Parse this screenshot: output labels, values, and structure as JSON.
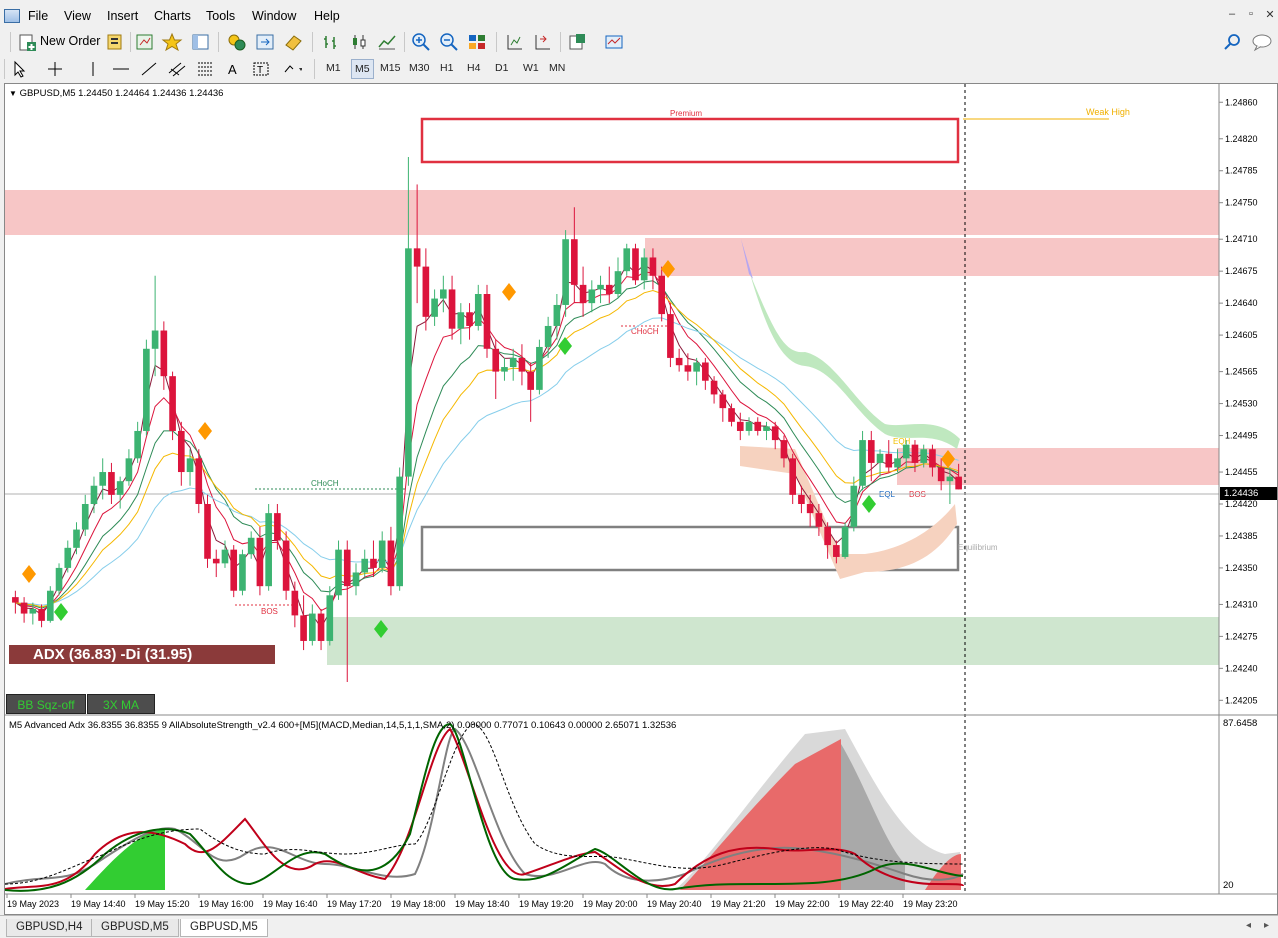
{
  "menu": {
    "items": [
      "File",
      "View",
      "Insert",
      "Charts",
      "Tools",
      "Window",
      "Help"
    ],
    "window_controls": [
      "–",
      "▫",
      "✕"
    ]
  },
  "toolbar": {
    "new_order_label": "New Order",
    "timeframes": [
      "M1",
      "M5",
      "M15",
      "M30",
      "H1",
      "H4",
      "D1",
      "W1",
      "MN"
    ],
    "active_timeframe": "M5"
  },
  "chart": {
    "header": "GBPUSD,M5  1.24450 1.24464 1.24436 1.24436",
    "current_price": "1.24436",
    "price_labels": [
      "1.24860",
      "1.24820",
      "1.24785",
      "1.24750",
      "1.24710",
      "1.24675",
      "1.24640",
      "1.24605",
      "1.24565",
      "1.24530",
      "1.24495",
      "1.24455",
      "1.24420",
      "1.24385",
      "1.24350",
      "1.24310",
      "1.24275",
      "1.24240",
      "1.24205"
    ],
    "time_labels": [
      "19 May 2023",
      "19 May 14:40",
      "19 May 15:20",
      "19 May 16:00",
      "19 May 16:40",
      "19 May 17:20",
      "19 May 18:00",
      "19 May 18:40",
      "19 May 19:20",
      "19 May 20:00",
      "19 May 20:40",
      "19 May 21:20",
      "19 May 22:00",
      "19 May 22:40",
      "19 May 23:20"
    ],
    "annotations": {
      "premium": "Premium",
      "weak_high": "Weak High",
      "equilibrium": "Equilibrium",
      "choch": "CHoCH",
      "bos": "BOS",
      "eqh": "EQH",
      "eql": "EQL"
    },
    "adx_label": "ADX (36.83)  -Di (31.95)",
    "bb_button": "BB Sqz-off",
    "ma_button": "3X MA",
    "subwindow_header": "M5 Advanced Adx 36.8355 36.8355      9 AllAbsoluteStrength_v2.4 600+[M5](MACD,Median,14,5,1,1,SMA,2) 0.00000 0.77071 0.10643 0.00000 2.65071 1.32536",
    "subwindow_top_value": "87.6458",
    "subwindow_bottom_value": "20",
    "colors": {
      "bull": "#3cb371",
      "bear": "#dc143c",
      "neutral": "#778899",
      "premium_zone": "#f7c6c6",
      "discount_zone": "#cfe6cf"
    }
  },
  "chart_data": {
    "type": "candlestick",
    "symbol": "GBPUSD",
    "timeframe": "M5",
    "ylim": [
      1.2419,
      1.2488
    ],
    "y_ticks": [
      1.2486,
      1.2482,
      1.24785,
      1.2475,
      1.2471,
      1.24675,
      1.2464,
      1.24605,
      1.24565,
      1.2453,
      1.24495,
      1.24455,
      1.2442,
      1.24385,
      1.2435,
      1.2431,
      1.24275,
      1.2424,
      1.24205
    ],
    "current_price": 1.24436,
    "candles": [
      [
        1.24318,
        1.24325,
        1.243,
        1.24312
      ],
      [
        1.24312,
        1.24318,
        1.2429,
        1.243
      ],
      [
        1.243,
        1.24312,
        1.24288,
        1.24305
      ],
      [
        1.24305,
        1.2431,
        1.24285,
        1.24292
      ],
      [
        1.24292,
        1.2433,
        1.2429,
        1.24325
      ],
      [
        1.24325,
        1.24355,
        1.2432,
        1.2435
      ],
      [
        1.2435,
        1.2438,
        1.24345,
        1.24372
      ],
      [
        1.24372,
        1.244,
        1.24365,
        1.24392
      ],
      [
        1.24392,
        1.2443,
        1.24385,
        1.2442
      ],
      [
        1.2442,
        1.2445,
        1.2441,
        1.2444
      ],
      [
        1.2444,
        1.2447,
        1.24425,
        1.24455
      ],
      [
        1.24455,
        1.24465,
        1.2442,
        1.2443
      ],
      [
        1.2443,
        1.2445,
        1.24415,
        1.24445
      ],
      [
        1.24445,
        1.2448,
        1.2444,
        1.2447
      ],
      [
        1.2447,
        1.2451,
        1.24465,
        1.245
      ],
      [
        1.245,
        1.246,
        1.24495,
        1.2459
      ],
      [
        1.2459,
        1.2467,
        1.2456,
        1.2461
      ],
      [
        1.2461,
        1.2462,
        1.24545,
        1.2456
      ],
      [
        1.2456,
        1.24565,
        1.2449,
        1.245
      ],
      [
        1.245,
        1.2451,
        1.2444,
        1.24455
      ],
      [
        1.24455,
        1.2448,
        1.2444,
        1.2447
      ],
      [
        1.2447,
        1.2448,
        1.2441,
        1.2442
      ],
      [
        1.2442,
        1.2443,
        1.2435,
        1.2436
      ],
      [
        1.2436,
        1.2437,
        1.2434,
        1.24355
      ],
      [
        1.24355,
        1.2438,
        1.2435,
        1.2437
      ],
      [
        1.2437,
        1.24375,
        1.24318,
        1.24325
      ],
      [
        1.24325,
        1.2437,
        1.2432,
        1.24365
      ],
      [
        1.24365,
        1.2439,
        1.2436,
        1.24383
      ],
      [
        1.24383,
        1.24395,
        1.2432,
        1.2433
      ],
      [
        1.2433,
        1.2442,
        1.24325,
        1.2441
      ],
      [
        1.2441,
        1.2442,
        1.2437,
        1.2438
      ],
      [
        1.2438,
        1.2439,
        1.24315,
        1.24325
      ],
      [
        1.24325,
        1.24335,
        1.24285,
        1.24298
      ],
      [
        1.24298,
        1.2432,
        1.2426,
        1.2427
      ],
      [
        1.2427,
        1.2431,
        1.24265,
        1.243
      ],
      [
        1.243,
        1.24305,
        1.2426,
        1.2427
      ],
      [
        1.2427,
        1.2433,
        1.24265,
        1.2432
      ],
      [
        1.2432,
        1.2438,
        1.24315,
        1.2437
      ],
      [
        1.2437,
        1.2438,
        1.24225,
        1.2433
      ],
      [
        1.2433,
        1.24355,
        1.2432,
        1.24345
      ],
      [
        1.24345,
        1.2437,
        1.2434,
        1.2436
      ],
      [
        1.2436,
        1.2438,
        1.2434,
        1.2435
      ],
      [
        1.2435,
        1.2439,
        1.24345,
        1.2438
      ],
      [
        1.2438,
        1.24395,
        1.2432,
        1.2433
      ],
      [
        1.2433,
        1.2446,
        1.24325,
        1.2445
      ],
      [
        1.2445,
        1.248,
        1.2444,
        1.247
      ],
      [
        1.247,
        1.2477,
        1.2464,
        1.2468
      ],
      [
        1.2468,
        1.247,
        1.2461,
        1.24625
      ],
      [
        1.24625,
        1.24655,
        1.24615,
        1.24645
      ],
      [
        1.24645,
        1.2467,
        1.2463,
        1.24655
      ],
      [
        1.24655,
        1.2467,
        1.246,
        1.24612
      ],
      [
        1.24612,
        1.2464,
        1.24595,
        1.2463
      ],
      [
        1.2463,
        1.2464,
        1.246,
        1.24615
      ],
      [
        1.24615,
        1.2466,
        1.2461,
        1.2465
      ],
      [
        1.2465,
        1.2466,
        1.2458,
        1.2459
      ],
      [
        1.2459,
        1.246,
        1.24535,
        1.24565
      ],
      [
        1.24565,
        1.2458,
        1.24555,
        1.2457
      ],
      [
        1.2457,
        1.2459,
        1.24555,
        1.2458
      ],
      [
        1.2458,
        1.24595,
        1.2455,
        1.24565
      ],
      [
        1.24565,
        1.24575,
        1.2451,
        1.24545
      ],
      [
        1.24545,
        1.246,
        1.2454,
        1.24592
      ],
      [
        1.24592,
        1.24625,
        1.2458,
        1.24615
      ],
      [
        1.24615,
        1.2465,
        1.246,
        1.24638
      ],
      [
        1.24638,
        1.2472,
        1.24625,
        1.2471
      ],
      [
        1.2471,
        1.24745,
        1.2464,
        1.2466
      ],
      [
        1.2466,
        1.2468,
        1.24625,
        1.2464
      ],
      [
        1.2464,
        1.24665,
        1.2463,
        1.24655
      ],
      [
        1.24655,
        1.2467,
        1.2464,
        1.2466
      ],
      [
        1.2466,
        1.2468,
        1.2464,
        1.2465
      ],
      [
        1.2465,
        1.2469,
        1.24645,
        1.24675
      ],
      [
        1.24675,
        1.24705,
        1.2467,
        1.247
      ],
      [
        1.247,
        1.24705,
        1.2466,
        1.24665
      ],
      [
        1.24665,
        1.247,
        1.24655,
        1.2469
      ],
      [
        1.2469,
        1.247,
        1.24655,
        1.2467
      ],
      [
        1.2467,
        1.2468,
        1.2462,
        1.24628
      ],
      [
        1.24628,
        1.2464,
        1.2457,
        1.2458
      ],
      [
        1.2458,
        1.2459,
        1.24565,
        1.24572
      ],
      [
        1.24572,
        1.24585,
        1.24555,
        1.24565
      ],
      [
        1.24565,
        1.2458,
        1.2455,
        1.24575
      ],
      [
        1.24575,
        1.2458,
        1.24545,
        1.24555
      ],
      [
        1.24555,
        1.2456,
        1.2453,
        1.2454
      ],
      [
        1.2454,
        1.24545,
        1.2451,
        1.24525
      ],
      [
        1.24525,
        1.2453,
        1.24505,
        1.2451
      ],
      [
        1.2451,
        1.2452,
        1.2449,
        1.245
      ],
      [
        1.245,
        1.24515,
        1.24495,
        1.2451
      ],
      [
        1.2451,
        1.24515,
        1.24495,
        1.245
      ],
      [
        1.245,
        1.2451,
        1.2449,
        1.24505
      ],
      [
        1.24505,
        1.2451,
        1.2448,
        1.2449
      ],
      [
        1.2449,
        1.24495,
        1.2446,
        1.2447
      ],
      [
        1.2447,
        1.24475,
        1.2442,
        1.2443
      ],
      [
        1.2443,
        1.2444,
        1.2441,
        1.2442
      ],
      [
        1.2442,
        1.2443,
        1.24395,
        1.2441
      ],
      [
        1.2441,
        1.2442,
        1.24385,
        1.24395
      ],
      [
        1.24395,
        1.244,
        1.2436,
        1.24375
      ],
      [
        1.24375,
        1.2438,
        1.24355,
        1.24362
      ],
      [
        1.24362,
        1.244,
        1.2436,
        1.24395
      ],
      [
        1.24395,
        1.2445,
        1.2439,
        1.2444
      ],
      [
        1.2444,
        1.245,
        1.24435,
        1.2449
      ],
      [
        1.2449,
        1.245,
        1.24445,
        1.24465
      ],
      [
        1.24465,
        1.2448,
        1.2445,
        1.24475
      ],
      [
        1.24475,
        1.2449,
        1.24455,
        1.2446
      ],
      [
        1.2446,
        1.2448,
        1.24455,
        1.2447
      ],
      [
        1.2447,
        1.2449,
        1.2446,
        1.24485
      ],
      [
        1.24485,
        1.2449,
        1.24455,
        1.24465
      ],
      [
        1.24465,
        1.24485,
        1.2446,
        1.2448
      ],
      [
        1.2448,
        1.24485,
        1.2445,
        1.2446
      ],
      [
        1.2446,
        1.2447,
        1.24435,
        1.24445
      ],
      [
        1.24445,
        1.2446,
        1.2442,
        1.2445
      ],
      [
        1.2445,
        1.24464,
        1.24436,
        1.24436
      ]
    ]
  }
}
